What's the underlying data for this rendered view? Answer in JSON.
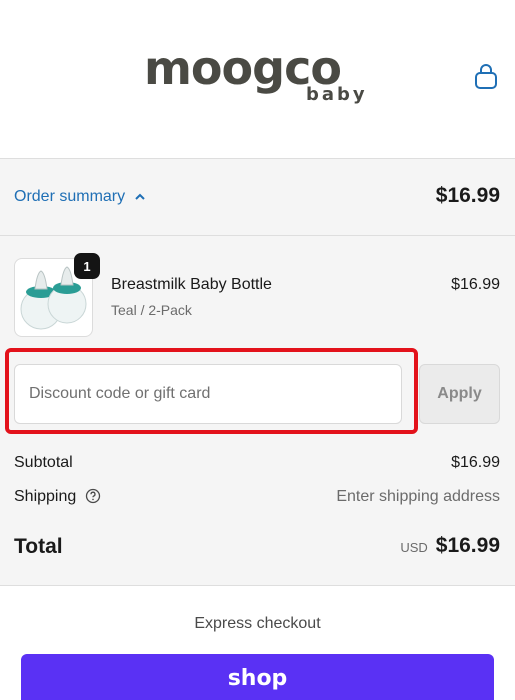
{
  "brand": {
    "logo_main": "moogco",
    "logo_sub": "baby"
  },
  "header": {
    "cart_icon": "shopping-bag-icon"
  },
  "order_summary": {
    "toggle_label": "Order summary",
    "toggle_icon": "chevron-up-icon",
    "total": "$16.99"
  },
  "items": [
    {
      "name": "Breastmilk Baby Bottle",
      "variant": "Teal / 2-Pack",
      "price": "$16.99",
      "quantity": "1"
    }
  ],
  "discount": {
    "placeholder": "Discount code or gift card",
    "value": "",
    "apply_label": "Apply"
  },
  "totals": {
    "subtotal_label": "Subtotal",
    "subtotal_value": "$16.99",
    "shipping_label": "Shipping",
    "shipping_value": "Enter shipping address",
    "total_label": "Total",
    "currency": "USD",
    "total_value": "$16.99"
  },
  "express": {
    "title": "Express checkout",
    "shop_label": "shop"
  },
  "colors": {
    "link": "#1f6fb5",
    "highlight": "#e3121b",
    "shop_pay": "#5a31f4",
    "bottle_teal": "#2a9d95"
  }
}
